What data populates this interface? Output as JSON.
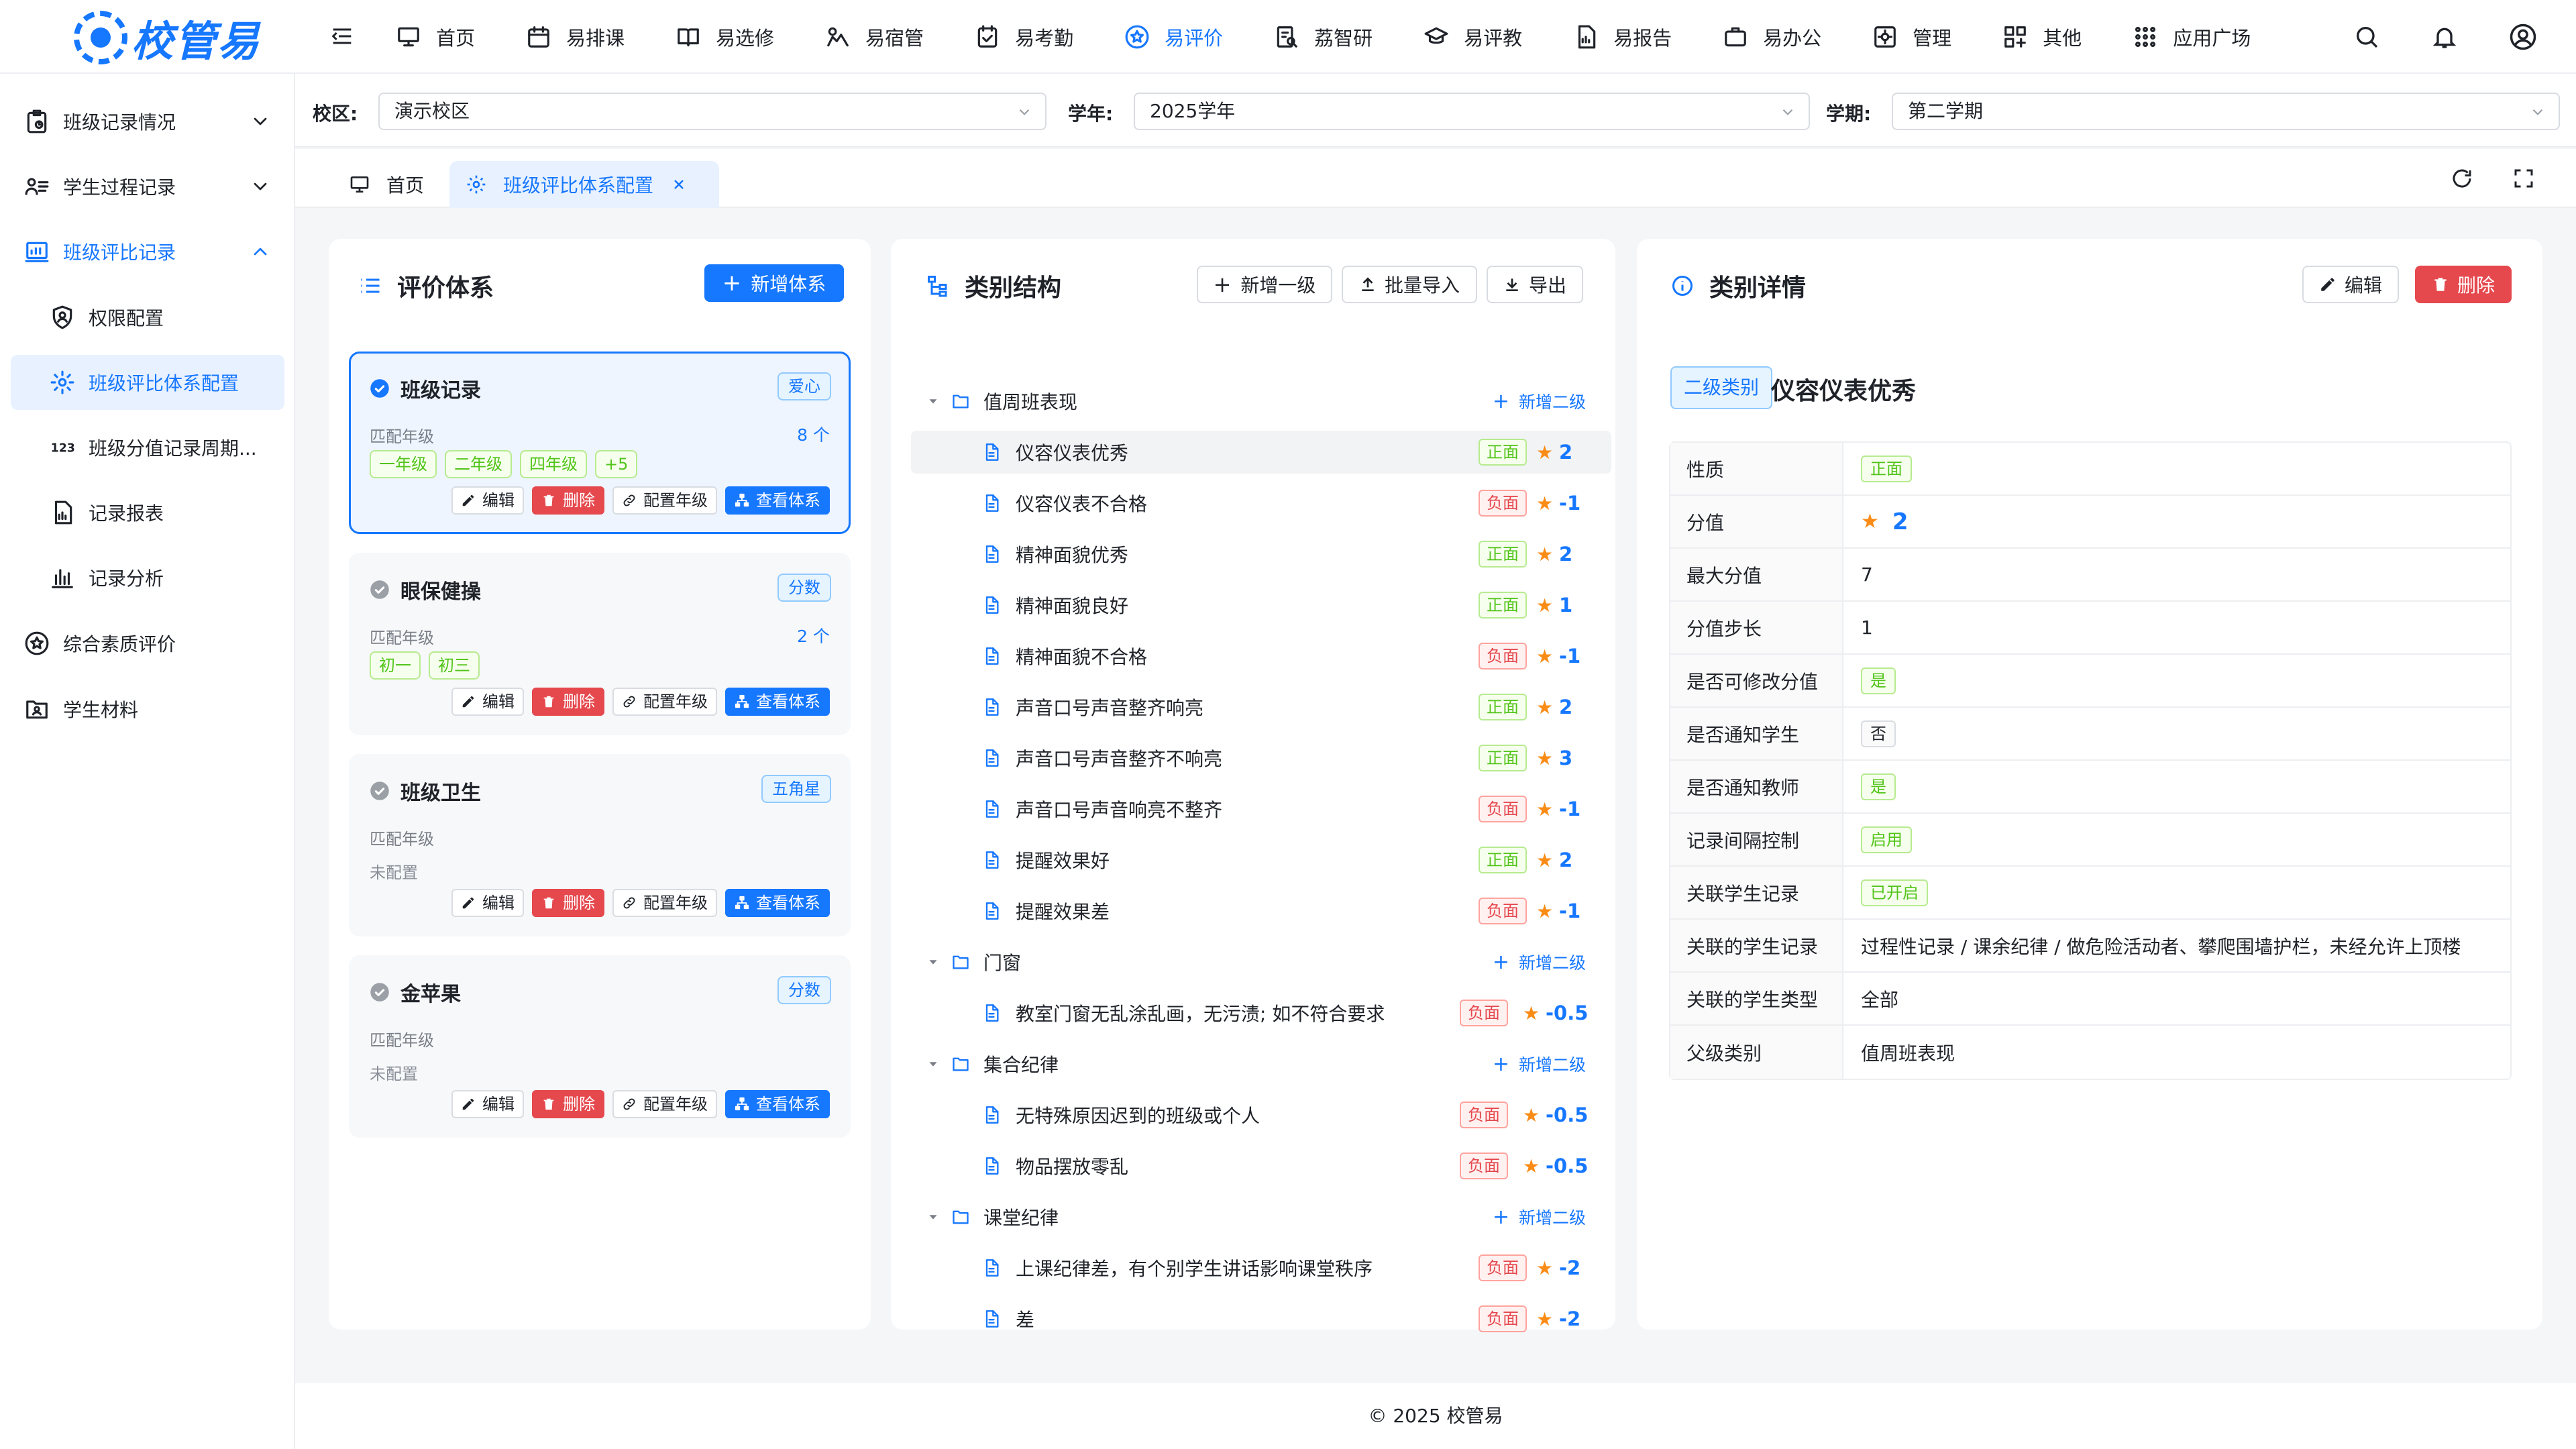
{
  "app": {
    "name": "校管易"
  },
  "nav": [
    {
      "label": "首页",
      "icon": "monitor-icon"
    },
    {
      "label": "易排课",
      "icon": "calendar-icon"
    },
    {
      "label": "易选修",
      "icon": "book-icon"
    },
    {
      "label": "易宿管",
      "icon": "bed-icon"
    },
    {
      "label": "易考勤",
      "icon": "check-calendar-icon"
    },
    {
      "label": "易评价",
      "icon": "star-circle-icon",
      "active": true
    },
    {
      "label": "荔智研",
      "icon": "research-icon"
    },
    {
      "label": "易评教",
      "icon": "graduation-cap-icon"
    },
    {
      "label": "易报告",
      "icon": "report-icon"
    },
    {
      "label": "易办公",
      "icon": "briefcase-icon"
    },
    {
      "label": "管理",
      "icon": "settings-box-icon"
    },
    {
      "label": "其他",
      "icon": "grid-plus-icon"
    },
    {
      "label": "应用广场",
      "icon": "apps-icon"
    }
  ],
  "sidebar": {
    "items": [
      {
        "label": "班级记录情况",
        "type": "parent",
        "icon": "clipboard-icon"
      },
      {
        "label": "学生过程记录",
        "type": "parent",
        "icon": "user-list-icon"
      },
      {
        "label": "班级评比记录",
        "type": "parent-open",
        "icon": "chart-board-icon"
      },
      {
        "label": "权限配置",
        "type": "child",
        "icon": "shield-user-icon"
      },
      {
        "label": "班级评比体系配置",
        "type": "child-selected",
        "icon": "gear-icon"
      },
      {
        "label": "班级分值记录周期...",
        "type": "child",
        "icon": "123-icon"
      },
      {
        "label": "记录报表",
        "type": "child",
        "icon": "file-chart-icon"
      },
      {
        "label": "记录分析",
        "type": "child",
        "icon": "bar-chart-icon"
      },
      {
        "label": "综合素质评价",
        "type": "parent",
        "icon": "star-circle-icon"
      },
      {
        "label": "学生材料",
        "type": "parent",
        "icon": "folder-user-icon"
      }
    ]
  },
  "filters": {
    "campus_label": "校区:",
    "campus_value": "演示校区",
    "year_label": "学年:",
    "year_value": "2025学年",
    "term_label": "学期:",
    "term_value": "第二学期"
  },
  "tabs": [
    {
      "label": "首页",
      "active": false
    },
    {
      "label": "班级评比体系配置",
      "active": true
    }
  ],
  "systems_panel": {
    "title": "评价体系",
    "add_button": "新增体系",
    "cards": [
      {
        "name": "班级记录",
        "badge": "爱心",
        "sub": "匹配年级",
        "count": "8 个",
        "tags": [
          "一年级",
          "二年级",
          "四年级",
          "+5"
        ],
        "empty": "",
        "selected": true
      },
      {
        "name": "眼保健操",
        "badge": "分数",
        "sub": "匹配年级",
        "count": "2 个",
        "tags": [
          "初一",
          "初三"
        ],
        "empty": "",
        "selected": false
      },
      {
        "name": "班级卫生",
        "badge": "五角星",
        "sub": "匹配年级",
        "count": "",
        "tags": [],
        "empty": "未配置",
        "selected": false
      },
      {
        "name": "金苹果",
        "badge": "分数",
        "sub": "匹配年级",
        "count": "",
        "tags": [],
        "empty": "未配置",
        "selected": false
      }
    ],
    "actions": {
      "edit": "编辑",
      "delete": "删除",
      "config": "配置年级",
      "view": "查看体系"
    }
  },
  "tree_panel": {
    "title": "类别结构",
    "add_top": "新增一级",
    "import": "批量导入",
    "export": "导出",
    "add_sub": "新增二级",
    "groups": [
      {
        "name": "值周班表现",
        "items": [
          {
            "name": "仪容仪表优秀",
            "kind": "正面",
            "score": "2",
            "selected": true
          },
          {
            "name": "仪容仪表不合格",
            "kind": "负面",
            "score": "-1"
          },
          {
            "name": "精神面貌优秀",
            "kind": "正面",
            "score": "2"
          },
          {
            "name": "精神面貌良好",
            "kind": "正面",
            "score": "1"
          },
          {
            "name": "精神面貌不合格",
            "kind": "负面",
            "score": "-1"
          },
          {
            "name": "声音口号声音整齐响亮",
            "kind": "正面",
            "score": "2"
          },
          {
            "name": "声音口号声音整齐不响亮",
            "kind": "正面",
            "score": "3"
          },
          {
            "name": "声音口号声音响亮不整齐",
            "kind": "负面",
            "score": "-1"
          },
          {
            "name": "提醒效果好",
            "kind": "正面",
            "score": "2"
          },
          {
            "name": "提醒效果差",
            "kind": "负面",
            "score": "-1"
          }
        ]
      },
      {
        "name": "门窗",
        "items": [
          {
            "name": "教室门窗无乱涂乱画，无污渍; 如不符合要求",
            "kind": "负面",
            "score": "-0.5"
          }
        ]
      },
      {
        "name": "集合纪律",
        "items": [
          {
            "name": "无特殊原因迟到的班级或个人",
            "kind": "负面",
            "score": "-0.5"
          },
          {
            "name": "物品摆放零乱",
            "kind": "负面",
            "score": "-0.5"
          }
        ]
      },
      {
        "name": "课堂纪律",
        "items": [
          {
            "name": "上课纪律差，有个别学生讲话影响课堂秩序",
            "kind": "负面",
            "score": "-2"
          },
          {
            "name": "差",
            "kind": "负面",
            "score": "-2"
          }
        ]
      }
    ]
  },
  "detail_panel": {
    "title": "类别详情",
    "edit": "编辑",
    "delete": "删除",
    "type_badge": "二级类别",
    "name": "仪容仪表优秀",
    "rows": [
      {
        "key": "性质",
        "value": "正面",
        "style": "tag-green"
      },
      {
        "key": "分值",
        "value": "2",
        "style": "score"
      },
      {
        "key": "最大分值",
        "value": "7",
        "style": "text"
      },
      {
        "key": "分值步长",
        "value": "1",
        "style": "text"
      },
      {
        "key": "是否可修改分值",
        "value": "是",
        "style": "tag-green"
      },
      {
        "key": "是否通知学生",
        "value": "否",
        "style": "tag-gray"
      },
      {
        "key": "是否通知教师",
        "value": "是",
        "style": "tag-green"
      },
      {
        "key": "记录间隔控制",
        "value": "启用",
        "style": "tag-green"
      },
      {
        "key": "关联学生记录",
        "value": "已开启",
        "style": "tag-green"
      },
      {
        "key": "关联的学生记录",
        "value": "过程性记录 / 课余纪律 / 做危险活动者、攀爬围墙护栏，未经允许上顶楼",
        "style": "text"
      },
      {
        "key": "关联的学生类型",
        "value": "全部",
        "style": "text"
      },
      {
        "key": "父级类别",
        "value": "值周班表现",
        "style": "text"
      }
    ]
  },
  "footer": "© 2025 校管易",
  "colors": {
    "primary": "#1677ff",
    "danger": "#e5484d",
    "positive": "#52c41a",
    "star": "#fa8c16"
  }
}
